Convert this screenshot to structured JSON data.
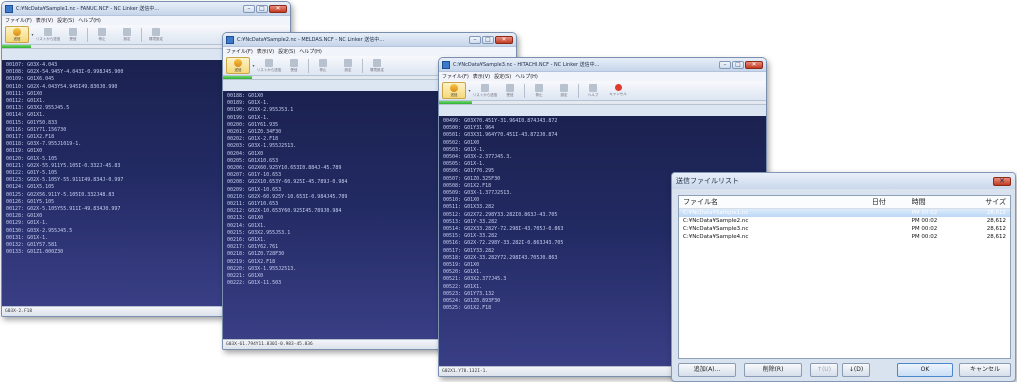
{
  "windows": [
    {
      "title": "C:¥NcData¥Sample1.nc - FANUC.NCF - NC Linker 送信中...",
      "menu": [
        "ファイル(F)",
        "表示(V)",
        "設定(S)",
        "ヘルプ(H)"
      ],
      "toolbar": [
        "送信",
        "リストから送信",
        "受信",
        "停止",
        "設定",
        "環境設定"
      ],
      "progress": 0.1,
      "lines": [
        "00107: G03X-4.043",
        "00108: G02X-54.945Y-4.043I-0.998J45.900",
        "00109: G01X6.045",
        "00110: G02X-4.043Y54.945I49.830J0.990",
        "00111: G01X0",
        "00112: G01X1.",
        "00113: G03X2.955J45.5",
        "00114: G01X1.",
        "00115: G01Y50.833",
        "00116: G01Y71.156730",
        "00117: G01X2.F18",
        "00118: G03X-7.955J1019-1.",
        "00119: G01X0",
        "00120: G01X-5.105",
        "00121: G02X-55.911Y5.105I-0.332J-45.83",
        "00122: G01Y-5.105",
        "00123: G02X-5.105Y-55.911I49.834J-0.997",
        "00124: G01X5.105",
        "00125: G02X56.911Y-5.105I0.332J48.83",
        "00126: G01Y5.105",
        "00127: G02X-5.105Y55.911I-49.834J0.997",
        "00128: G01X0",
        "00129: G01X-1.",
        "00130: G03X-2.955J45.5",
        "00131: G01X-1.",
        "00132: G01Y57.581",
        "00133: G01Z1.000Z30"
      ],
      "status": "G03X-2.F18"
    },
    {
      "title": "C:¥NcData¥Sample2.nc - MELDAS.NCF - NC Linker 送信中...",
      "menu": [
        "ファイル(F)",
        "表示(V)",
        "設定(S)",
        "ヘルプ(H)"
      ],
      "toolbar": [
        "送信",
        "リストから送信",
        "受信",
        "停止",
        "設定",
        "環境設定"
      ],
      "progress": 0.1,
      "lines": [
        "00188: G01X0",
        "00189: G01X-1.",
        "00190: G03X-2.955J53.1",
        "00199: G01X-1.",
        "00200: G01Y61.935",
        "00201: G01Z0.34F30",
        "00202: G01X-2.F18",
        "00203: G03X-1.955J2513.",
        "00204: G01X0",
        "00205: G01X10.653",
        "00206: G02X60.925Y10.653I0.884J-45.789",
        "00207: G01Y-10.653",
        "00208: G02X10.653Y-60.925I-45.789J-0.984",
        "00209: G01X-10.653",
        "00210: G02X-60.925Y-10.653I-0.984J45.789",
        "00211: G01Y10.653",
        "00212: G02X-10.653Y60.925I45.789J0.984",
        "00213: G01X0",
        "00214: G01X1.",
        "00215: G03X2.955J53.1",
        "00216: G01X1.",
        "00217: G01Y62.761",
        "00218: G01Z0.728F30",
        "00219: G01X2.F18",
        "00220: G03X-1.955J2513.",
        "00221: G01X0",
        "00222: G01X-11.503"
      ],
      "status": "G03X-61.794Y11.830I-0.983-45.836"
    },
    {
      "title": "C:¥NcData¥Sample3.nc - HITACHI.NCF - NC Linker 送信中...",
      "menu": [
        "ファイル(F)",
        "表示(V)",
        "設定(S)",
        "ヘルプ(H)"
      ],
      "toolbar": [
        "送信",
        "リストから送信",
        "受信",
        "停止",
        "設定",
        "ヘルプ",
        "キャンセル"
      ],
      "progress": 0.1,
      "lines": [
        "00499: G03X70.451Y-31.964I0.874J43.872",
        "00500: G01Y31.964",
        "00501: G03X31.964Y70.451I-43.872J0.874",
        "00502: G01X0",
        "00503: G01X-1.",
        "00504: G03X-2.377J45.3.",
        "00505: G01X-1.",
        "00506: G01Y70.295",
        "00507: G01Z0.325F30",
        "00508: G01X2.F18",
        "00509: G03X-1.377J2513.",
        "00510: G01X0",
        "00511: G01X33.282",
        "00512: G02X72.298Y33.282I0.863J-43.705",
        "00513: G01Y-33.282",
        "00514: G02X33.282Y-72.298I-43.705J-0.863",
        "00515: G01X-33.282",
        "00516: G02X-72.298Y-33.282I-0.863J43.705",
        "00517: G01Y33.282",
        "00518: G02X-33.282Y72.298I43.705J0.863",
        "00519: G01X0",
        "00520: G01X1.",
        "00521: G03X2.377J45.3",
        "00522: G01X1.",
        "00523: G01Y73.132",
        "00524: G01Z0.893F30",
        "00525: G01X2.F18"
      ],
      "status": "G02X1.Y78.132I-1."
    }
  ],
  "dialog": {
    "title": "送信ファイルリスト",
    "columns": [
      "ファイル名",
      "日付",
      "時間",
      "サイズ"
    ],
    "rows": [
      {
        "name": "C:¥NcData¥Sample1.nc",
        "date": "",
        "time": "PM 00:02",
        "size": "28,612",
        "selected": true
      },
      {
        "name": "C:¥NcData¥Sample2.nc",
        "date": "",
        "time": "PM 00:02",
        "size": "28,612",
        "selected": false
      },
      {
        "name": "C:¥NcData¥Sample3.nc",
        "date": "",
        "time": "PM 00:02",
        "size": "28,612",
        "selected": false
      },
      {
        "name": "C:¥NcData¥Sample4.nc",
        "date": "",
        "time": "PM 00:02",
        "size": "28,612",
        "selected": false
      }
    ],
    "buttons": {
      "add": "追加(A)...",
      "delete": "削除(R)",
      "up": "↑(U)",
      "down": "↓(D)",
      "ok": "OK",
      "cancel": "キャンセル"
    }
  }
}
